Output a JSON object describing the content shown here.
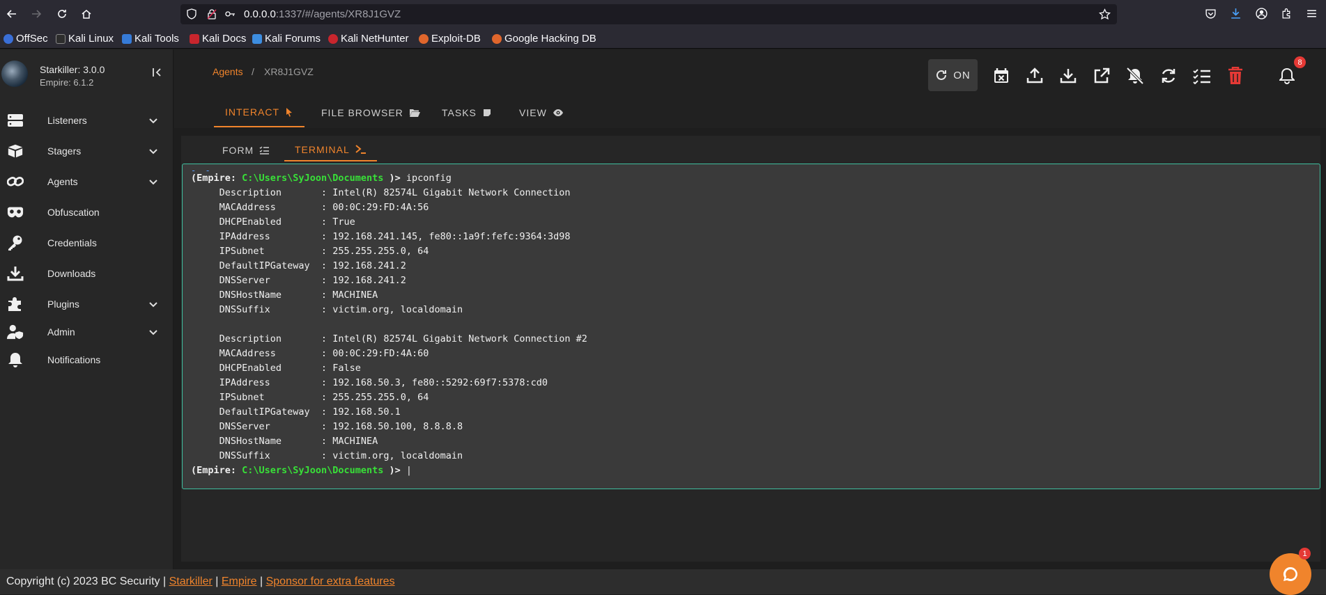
{
  "browser": {
    "url_host": "0.0.0.0",
    "url_rest": ":1337/#/agents/XR8J1GVZ",
    "bookmarks": [
      "OffSec",
      "Kali Linux",
      "Kali Tools",
      "Kali Docs",
      "Kali Forums",
      "Kali NetHunter",
      "Exploit-DB",
      "Google Hacking DB"
    ]
  },
  "brand": {
    "title": "Starkiller: 3.0.0",
    "subtitle": "Empire: 6.1.2"
  },
  "sidebar": {
    "items": [
      {
        "label": "Listeners",
        "icon": "server-icon",
        "expandable": true
      },
      {
        "label": "Stagers",
        "icon": "box-icon",
        "expandable": true
      },
      {
        "label": "Agents",
        "icon": "link-icon",
        "expandable": true
      },
      {
        "label": "Obfuscation",
        "icon": "mask-icon",
        "expandable": false
      },
      {
        "label": "Credentials",
        "icon": "key-icon",
        "expandable": false
      },
      {
        "label": "Downloads",
        "icon": "download-icon",
        "expandable": false
      },
      {
        "label": "Plugins",
        "icon": "puzzle-icon",
        "expandable": true
      },
      {
        "label": "Admin",
        "icon": "admin-icon",
        "expandable": true
      },
      {
        "label": "Notifications",
        "icon": "bell-icon",
        "expandable": false
      }
    ]
  },
  "breadcrumb": {
    "root": "Agents",
    "separator": "/",
    "current": "XR8J1GVZ"
  },
  "toolbar": {
    "toggle_label": "ON",
    "notification_count": "8"
  },
  "tabs": [
    "INTERACT",
    "FILE BROWSER",
    "TASKS",
    "VIEW"
  ],
  "subtabs": [
    "FORM",
    "TERMINAL"
  ],
  "terminal": {
    "prompt_prefix": "(Empire: ",
    "prompt_path": "C:\\Users\\SyJoon\\Documents",
    "prompt_suffix": " )> ",
    "command": "ipconfig",
    "lines": [
      "     Description       : Intel(R) 82574L Gigabit Network Connection",
      "     MACAddress        : 00:0C:29:FD:4A:56",
      "     DHCPEnabled       : True",
      "     IPAddress         : 192.168.241.145, fe80::1a9f:fefc:9364:3d98",
      "     IPSubnet          : 255.255.255.0, 64",
      "     DefaultIPGateway  : 192.168.241.2",
      "     DNSServer         : 192.168.241.2",
      "     DNSHostName       : MACHINEA",
      "     DNSSuffix         : victim.org, localdomain",
      "",
      "     Description       : Intel(R) 82574L Gigabit Network Connection #2",
      "     MACAddress        : 00:0C:29:FD:4A:60",
      "     DHCPEnabled       : False",
      "     IPAddress         : 192.168.50.3, fe80::5292:69f7:5378:cd0",
      "     IPSubnet          : 255.255.255.0, 64",
      "     DefaultIPGateway  : 192.168.50.1",
      "     DNSServer         : 192.168.50.100, 8.8.8.8",
      "     DNSHostName       : MACHINEA",
      "     DNSSuffix         : victim.org, localdomain"
    ]
  },
  "footer": {
    "text": "Copyright (c) 2023 BC Security | ",
    "sep": " | ",
    "link1": "Starkiller",
    "link2": "Empire",
    "link3": "Sponsor for extra features"
  },
  "chat": {
    "badge": "1"
  },
  "colors": {
    "accent": "#f0842c",
    "terminal_border": "#3fbf9f",
    "prompt_path": "#38e038",
    "delete": "#e53935"
  }
}
